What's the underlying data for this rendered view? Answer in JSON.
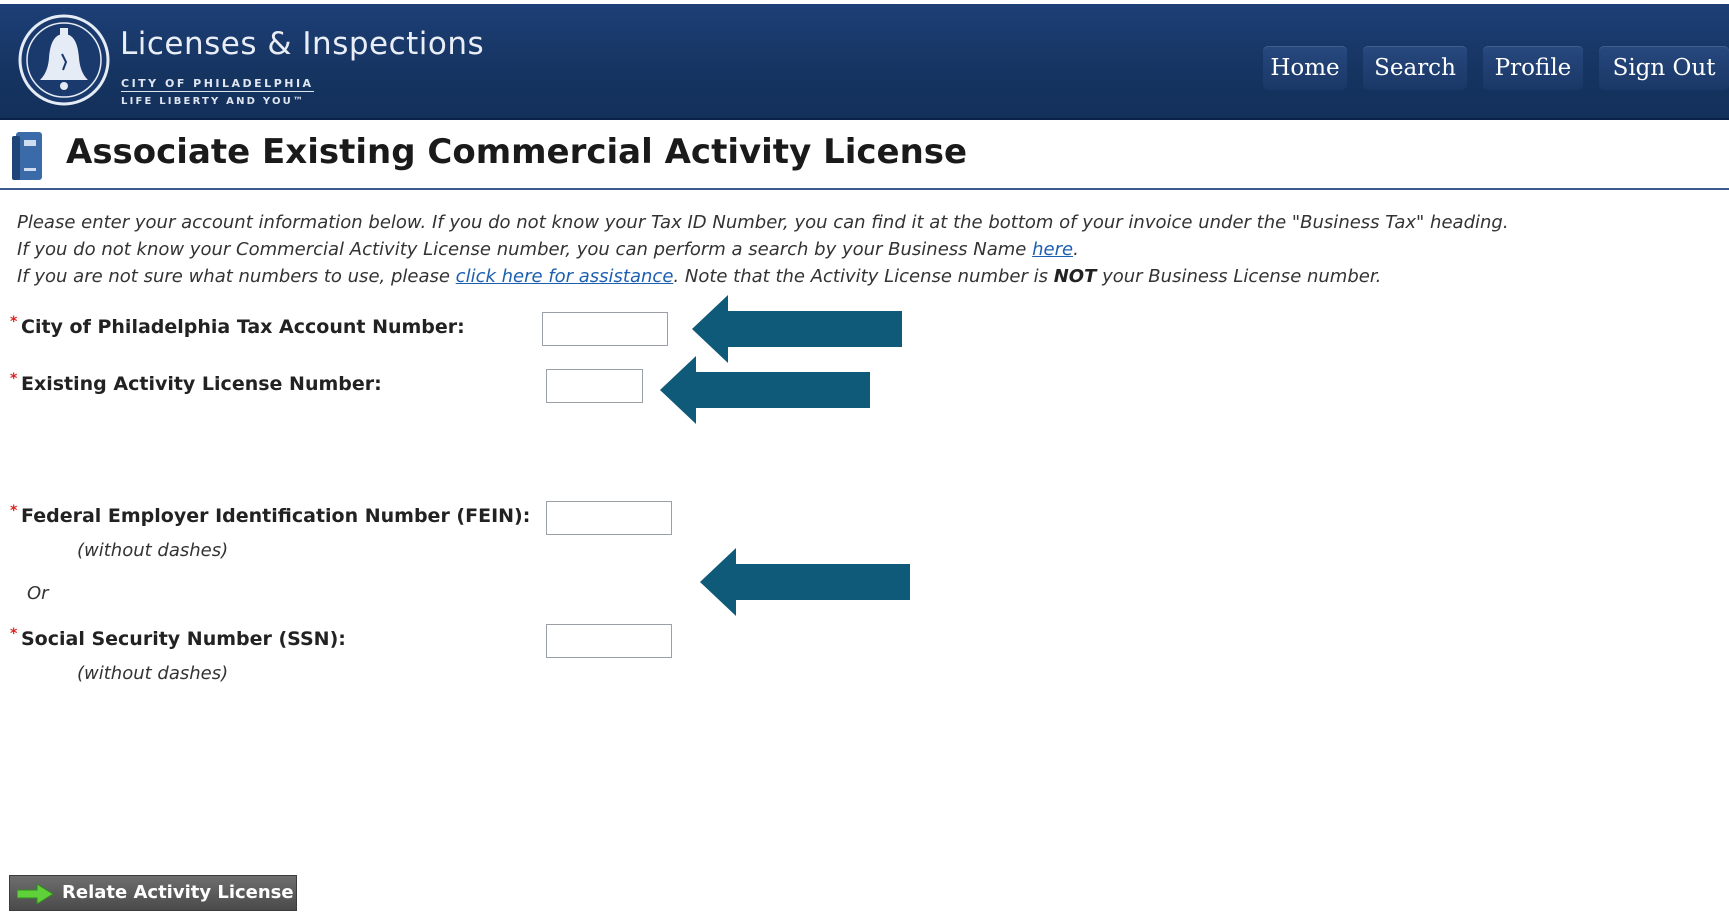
{
  "header": {
    "brand_title": "Licenses & Inspections",
    "brand_sub1": "CITY OF PHILADELPHIA",
    "brand_sub2": "LIFE LIBERTY AND YOU™",
    "logo_icon": "liberty-bell-seal-icon",
    "nav": [
      {
        "label": "Home"
      },
      {
        "label": "Search"
      },
      {
        "label": "Profile"
      },
      {
        "label": "Sign Out"
      }
    ]
  },
  "page": {
    "title": "Associate Existing Commercial Activity License",
    "title_icon": "binder-icon"
  },
  "instructions": {
    "line1": "Please enter your account information below. If you do not know your Tax ID Number, you can find it at the bottom of your invoice under the \"Business Tax\" heading.",
    "line2_before": "If you do not know your Commercial Activity License number, you can perform a search by your Business Name ",
    "line2_link": "here",
    "line2_after": ".",
    "line3_before": "If you are not sure what numbers to use, please ",
    "line3_link": "click here for assistance",
    "line3_mid": ". Note that the Activity License number is ",
    "line3_bold": "NOT",
    "line3_after": " your Business License number."
  },
  "form": {
    "required_marker": "*",
    "tax_account_label": "City of Philadelphia Tax Account Number:",
    "tax_account_value": "",
    "license_label": "Existing Activity License Number:",
    "license_value": "",
    "fein_label": "Federal Employer Identification Number (FEIN):",
    "fein_hint": "(without dashes)",
    "fein_value": "",
    "or_text": "Or",
    "ssn_label": "Social Security Number (SSN):",
    "ssn_hint": "(without dashes)",
    "ssn_value": ""
  },
  "annotations": {
    "arrow_color": "#0e5a78",
    "arrow_icon": "left-arrow-icon"
  },
  "actions": {
    "submit_label": "Relate Activity License",
    "submit_icon": "green-right-arrow-icon"
  }
}
